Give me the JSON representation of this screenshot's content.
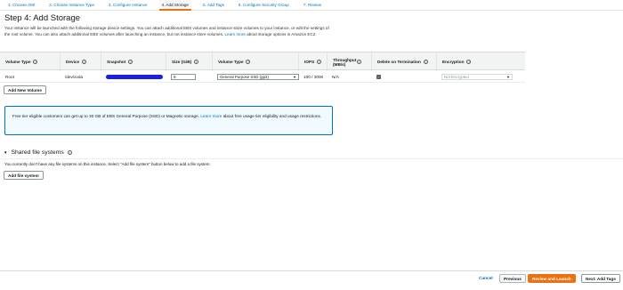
{
  "wizard": {
    "steps": [
      "1. Choose AMI",
      "2. Choose Instance Type",
      "3. Configure Instance",
      "4. Add Storage",
      "5. Add Tags",
      "6. Configure Security Group",
      "7. Review"
    ],
    "active_step": 3
  },
  "page": {
    "title": "Step 4: Add Storage",
    "intro_text": "Your instance will be launched with the following storage device settings. You can attach additional EBS volumes and instance store volumes to your instance, or edit the settings of the root volume. You can also attach additional EBS volumes after launching an instance, but not instance store volumes.",
    "intro_link": "Learn more",
    "intro_tail": "about storage options in Amazon EC2."
  },
  "table": {
    "headers": {
      "volume_type": "Volume Type",
      "device": "Device",
      "snapshot": "Snapshot",
      "size": "Size (GiB)",
      "volume_type2": "Volume Type",
      "iops": "IOPS",
      "throughput": "Throughput (MB/s)",
      "delete_on_termination": "Delete on Termination",
      "encryption": "Encryption"
    },
    "info_glyph": "i",
    "row": {
      "volume_type": "Root",
      "device": "/dev/xvda",
      "size": "8",
      "ebs_volume_type": "General Purpose SSD (gp2)",
      "iops": "100 / 3000",
      "throughput": "N/A",
      "delete_on_termination": true,
      "encryption": "Not Encrypted"
    }
  },
  "buttons": {
    "add_new_volume": "Add New Volume",
    "add_file_system": "Add file system",
    "cancel": "Cancel",
    "previous": "Previous",
    "review_and_launch": "Review and Launch",
    "next_add_tags": "Next: Add Tags"
  },
  "info_box": {
    "text": "Free tier eligible customers can get up to 30 GB of EBS General Purpose (SSD) or Magnetic storage.",
    "link": "Learn more",
    "tail": "about free usage tier eligibility and usage restrictions."
  },
  "shared_fs": {
    "title": "Shared file systems",
    "note": "You currently don't have any file systems on this instance. Select \"Add file system\" button below to add a file system."
  },
  "icons": {
    "caret": "caret-down-icon",
    "info": "info-icon",
    "chevron": "chevron-down-icon",
    "checkmark": "check-icon"
  },
  "colors": {
    "primary": "#ec7211",
    "link": "#0073bb",
    "info_box_bg": "#f1faff"
  }
}
